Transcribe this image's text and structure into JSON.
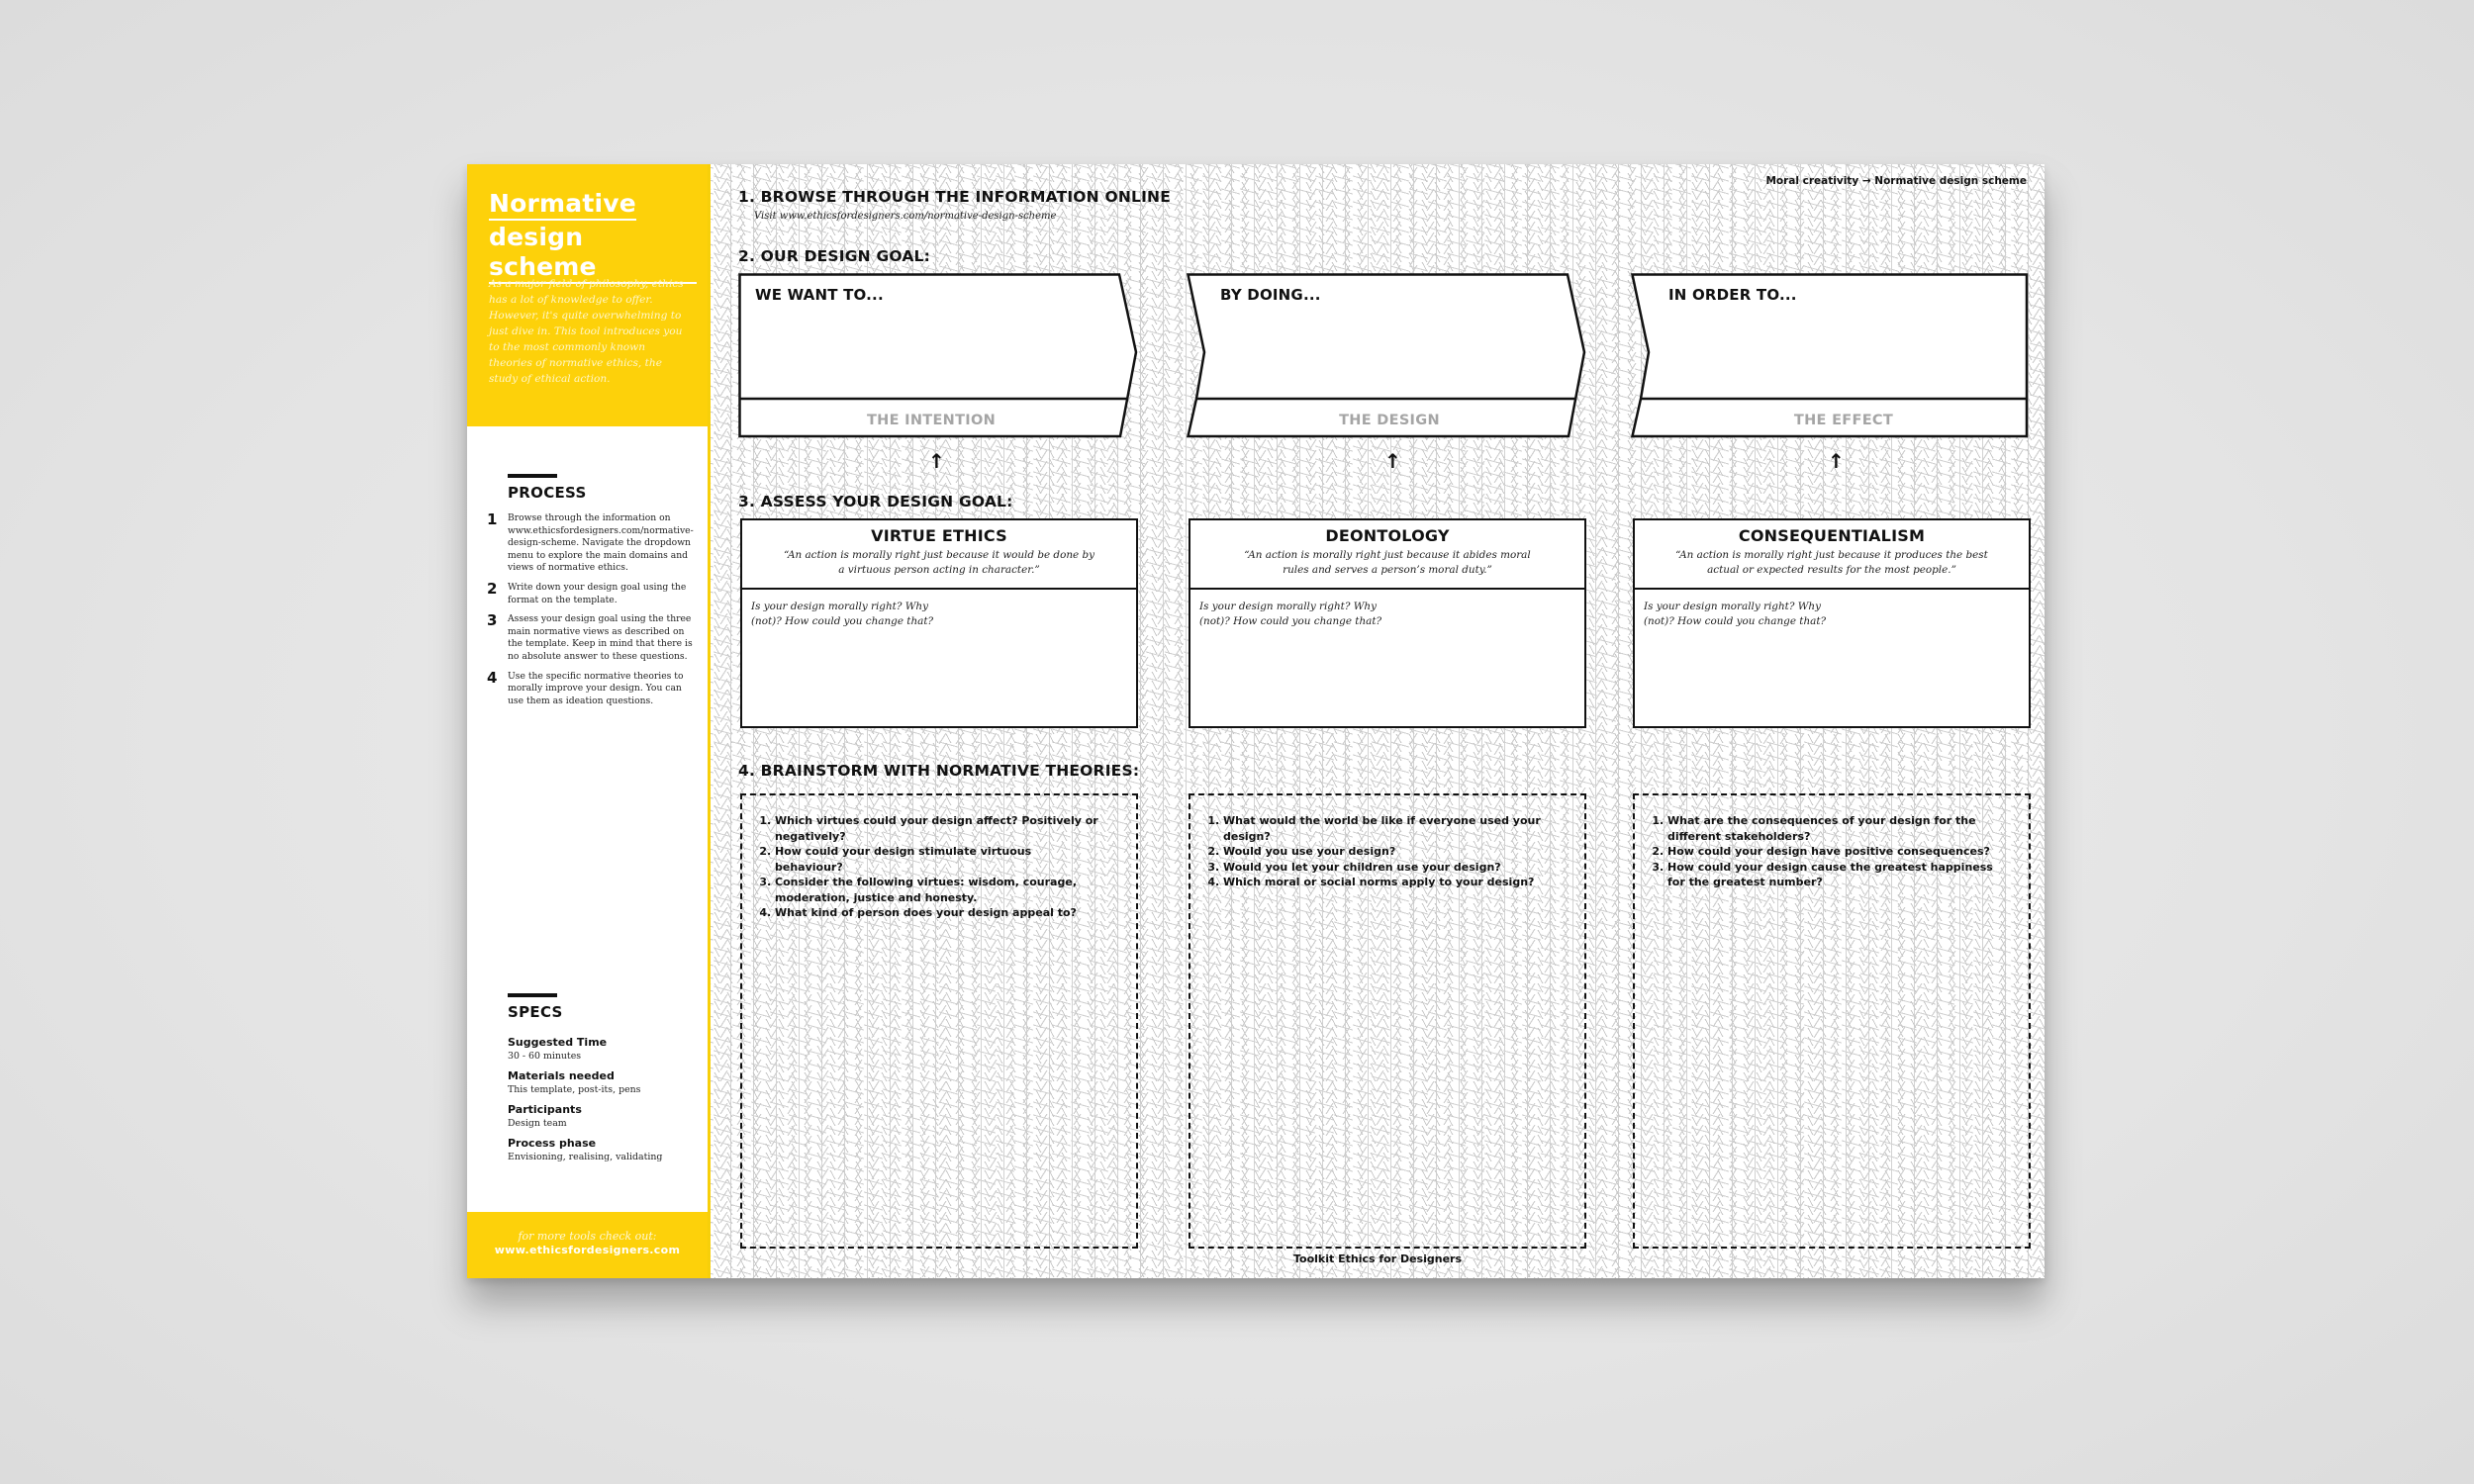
{
  "sidebar": {
    "title_line1": "Normative",
    "title_line2": "design scheme",
    "intro": "As a major field of philosophy, ethics has a lot of knowledge to offer. However, it's quite overwhelming to just dive in. This tool introduces you to the most commonly known theories of normative ethics, the study of ethical action.",
    "process": {
      "heading": "PROCESS",
      "steps": [
        {
          "num": "1",
          "text": "Browse through the information on www.ethicsfordesigners.com/normative-design-scheme. Navigate the dropdown menu to explore the main domains and views of normative ethics."
        },
        {
          "num": "2",
          "text": "Write down your design goal using the format on the template."
        },
        {
          "num": "3",
          "text": "Assess your design goal using the three main normative views as described on the template. Keep in mind that there is no absolute answer to these questions."
        },
        {
          "num": "4",
          "text": "Use the specific normative theories to morally improve your design. You can use them as ideation questions."
        }
      ]
    },
    "specs": {
      "heading": "SPECS",
      "items": [
        {
          "label": "Suggested Time",
          "value": "30 - 60 minutes"
        },
        {
          "label": "Materials needed",
          "value": "This template, post-its, pens"
        },
        {
          "label": "Participants",
          "value": "Design team"
        },
        {
          "label": "Process phase",
          "value": "Envisioning, realising, validating"
        }
      ]
    },
    "footer": {
      "more": "for more tools check out:",
      "site": "www.ethicsfordesigners.com"
    }
  },
  "main": {
    "breadcrumb": "Moral creativity → Normative design scheme",
    "step1": {
      "heading": "1. BROWSE THROUGH THE INFORMATION ONLINE",
      "visit": "Visit www.ethicsfordesigners.com/normative-design-scheme"
    },
    "step2": {
      "heading": "2. OUR DESIGN GOAL:",
      "boxes": [
        {
          "head": "WE WANT TO...",
          "foot": "THE INTENTION"
        },
        {
          "head": "BY DOING...",
          "foot": "THE DESIGN"
        },
        {
          "head": "IN ORDER TO...",
          "foot": "THE EFFECT"
        }
      ],
      "arrow": "↑"
    },
    "step3": {
      "heading": "3. ASSESS YOUR DESIGN GOAL:",
      "views": [
        {
          "title": "VIRTUE ETHICS",
          "quote": "“An action is morally right just because it would be done by a virtuous person acting in character.”",
          "question": "Is your design morally right? Why (not)? How could you change that?"
        },
        {
          "title": "DEONTOLOGY",
          "quote": "“An action is morally right just because it abides moral rules and serves a person’s moral duty.”",
          "question": "Is your design morally right? Why (not)? How could you change that?"
        },
        {
          "title": "CONSEQUENTIALISM",
          "quote": "“An action is morally right just because it produces the best actual or expected results for the most people.”",
          "question": "Is your design morally right? Why (not)? How could you change that?"
        }
      ]
    },
    "step4": {
      "heading": "4. BRAINSTORM WITH NORMATIVE THEORIES:",
      "lists": [
        [
          "Which virtues could your design affect? Positively or negatively?",
          "How could your design stimulate virtuous behaviour?",
          "Consider the following virtues: wisdom, courage, moderation, justice and honesty.",
          "What kind of person does your design appeal to?"
        ],
        [
          "What would the world be like if everyone used your design?",
          "Would you use your design?",
          "Would you let your children use your design?",
          "Which moral or social norms apply to your design?"
        ],
        [
          "What are the consequences of your design for the different stakeholders?",
          "How could your design have positive consequences?",
          "How could your design cause the greatest happiness for the greatest number?"
        ]
      ]
    },
    "footer": "Toolkit Ethics for Designers"
  },
  "colors": {
    "accent_yellow": "#fdd10a",
    "ink": "#111111",
    "muted_label": "#a5a5a5"
  }
}
